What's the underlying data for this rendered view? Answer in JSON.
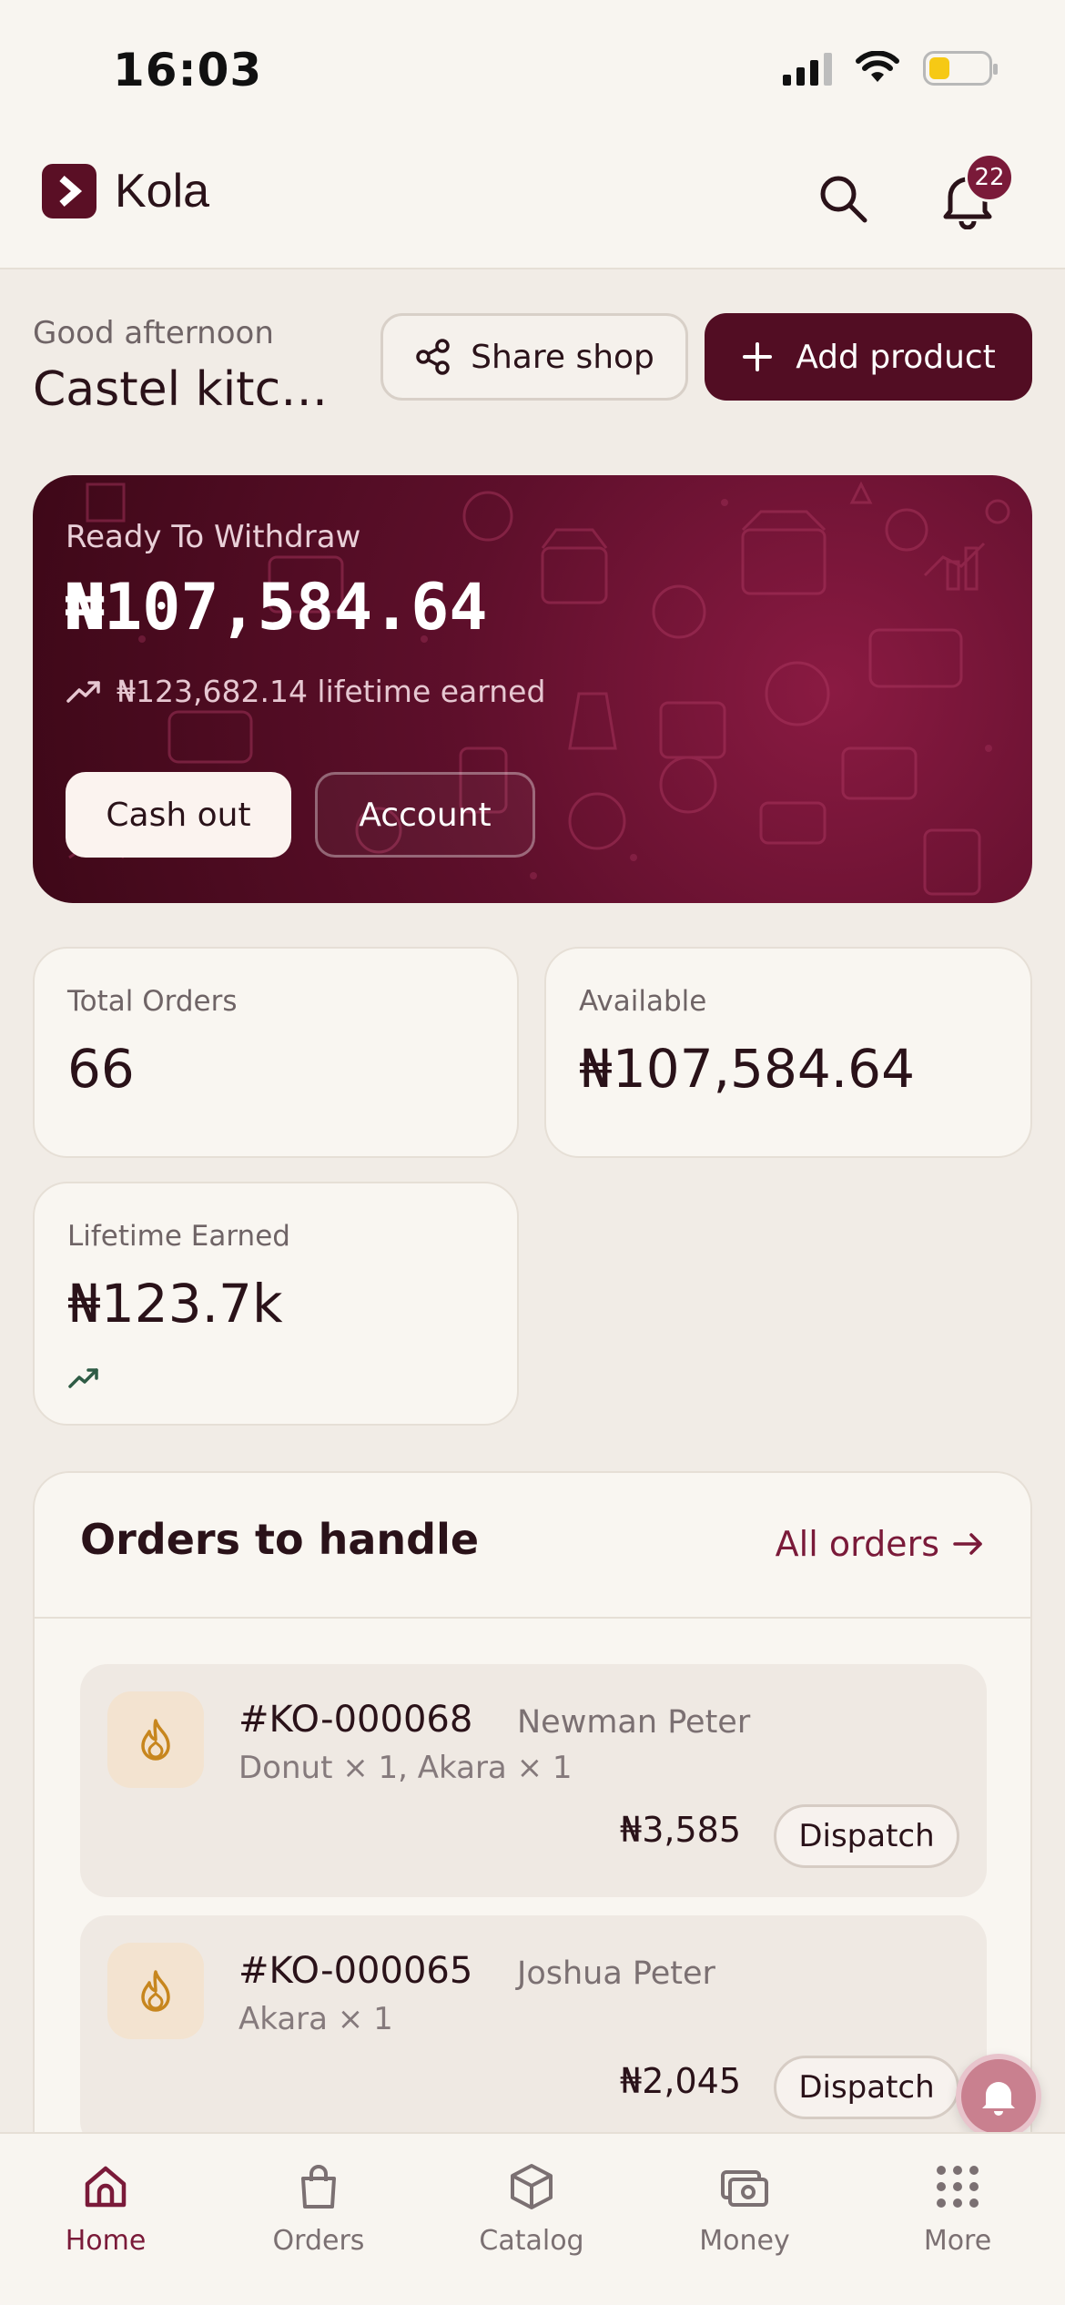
{
  "status_bar": {
    "time": "16:03"
  },
  "app": {
    "name": "Kola",
    "notification_count": "22"
  },
  "greeting": {
    "salutation": "Good afternoon",
    "shop_name": "Castel kitch..."
  },
  "actions": {
    "share_label": "Share shop",
    "add_label": "Add product"
  },
  "wallet": {
    "label": "Ready To Withdraw",
    "amount": "₦107,584.64",
    "lifetime": "₦123,682.14 lifetime earned",
    "cashout_label": "Cash out",
    "account_label": "Account"
  },
  "stats": {
    "total_orders": {
      "label": "Total Orders",
      "value": "66"
    },
    "available": {
      "label": "Available",
      "value": "₦107,584.64"
    },
    "lifetime": {
      "label": "Lifetime Earned",
      "value": "₦123.7k"
    }
  },
  "orders": {
    "title": "Orders to handle",
    "all_label": "All orders",
    "items": [
      {
        "id": "#KO-000068",
        "customer": "Newman Peter",
        "items": "Donut × 1, Akara × 1",
        "price": "₦3,585",
        "action": "Dispatch"
      },
      {
        "id": "#KO-000065",
        "customer": "Joshua Peter",
        "items": "Akara × 1",
        "price": "₦2,045",
        "action": "Dispatch"
      }
    ]
  },
  "nav": {
    "items": [
      {
        "label": "Home",
        "icon": "home-icon",
        "active": true
      },
      {
        "label": "Orders",
        "icon": "bag-icon",
        "active": false
      },
      {
        "label": "Catalog",
        "icon": "box-icon",
        "active": false
      },
      {
        "label": "Money",
        "icon": "money-icon",
        "active": false
      },
      {
        "label": "More",
        "icon": "grid-icon",
        "active": false
      }
    ]
  },
  "colors": {
    "brand": "#520d23",
    "accent": "#7a1a39",
    "background": "#f1ece6",
    "flame": "#c7861e"
  }
}
